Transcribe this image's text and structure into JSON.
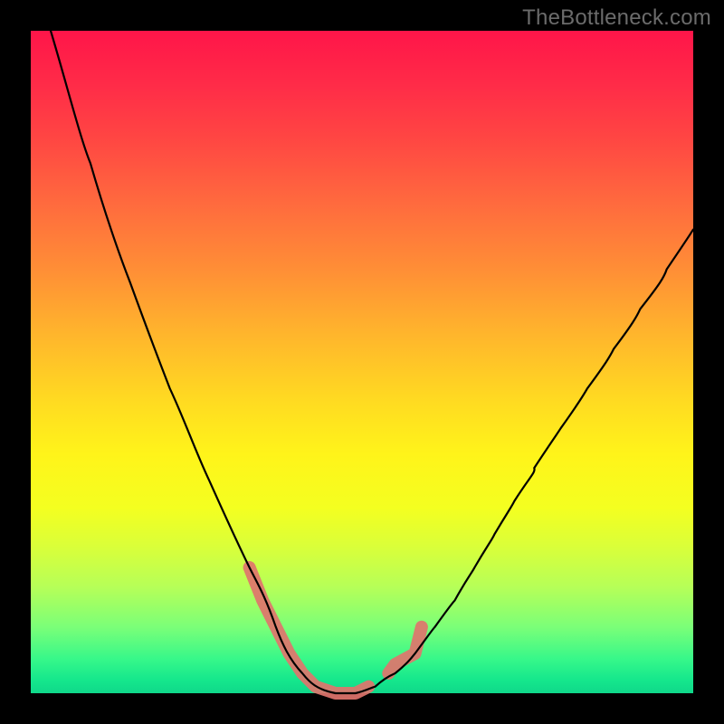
{
  "attribution": "TheBottleneck.com",
  "colors": {
    "highlight": "#e0746d",
    "curve": "#000000",
    "frame": "#000000"
  },
  "chart_data": {
    "type": "line",
    "title": "",
    "xlabel": "",
    "ylabel": "",
    "xlim": [
      0,
      100
    ],
    "ylim": [
      0,
      100
    ],
    "x": [
      3,
      6,
      9,
      12,
      15,
      18,
      21,
      24,
      27,
      30,
      33,
      35,
      37,
      39,
      41,
      43,
      46,
      49,
      52,
      55,
      58,
      61,
      64,
      67,
      70,
      73,
      76,
      80,
      84,
      88,
      92,
      96,
      100
    ],
    "y": [
      100,
      90,
      80,
      71,
      62,
      54,
      46,
      39,
      32,
      25,
      19,
      14,
      10,
      6,
      3,
      1,
      0,
      0,
      1,
      3,
      6,
      10,
      14,
      19,
      24,
      29,
      34,
      40,
      46,
      52,
      58,
      64,
      70
    ],
    "series_name": "bottleneck-curve",
    "highlight_ranges": [
      {
        "x_start": 33,
        "x_end": 51,
        "note": "trough-segment"
      },
      {
        "x_start": 54,
        "x_end": 59,
        "note": "right-arm-segment"
      }
    ],
    "background_gradient": "rainbow-vertical: red (top, high bottleneck) → green (bottom, low bottleneck)"
  }
}
